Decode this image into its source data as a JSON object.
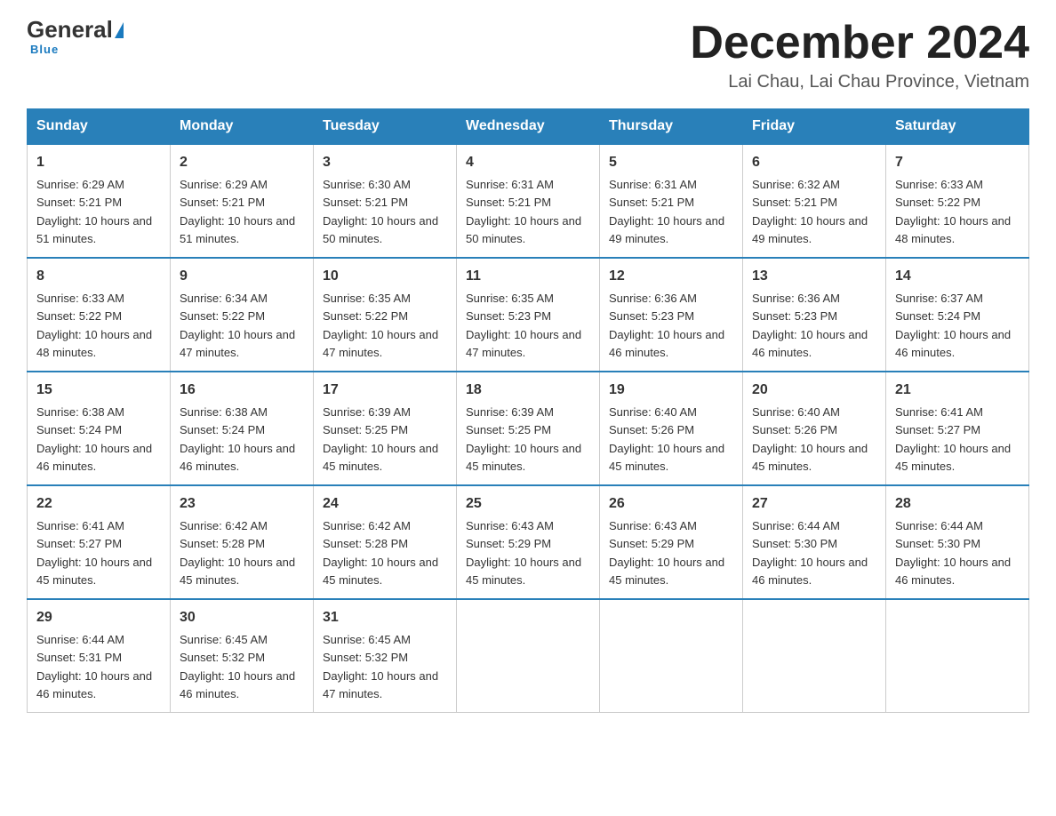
{
  "logo": {
    "general": "General",
    "blue": "Blue",
    "underline": "Blue"
  },
  "header": {
    "month_title": "December 2024",
    "location": "Lai Chau, Lai Chau Province, Vietnam"
  },
  "days_of_week": [
    "Sunday",
    "Monday",
    "Tuesday",
    "Wednesday",
    "Thursday",
    "Friday",
    "Saturday"
  ],
  "weeks": [
    [
      {
        "day": "1",
        "sunrise": "6:29 AM",
        "sunset": "5:21 PM",
        "daylight": "10 hours and 51 minutes."
      },
      {
        "day": "2",
        "sunrise": "6:29 AM",
        "sunset": "5:21 PM",
        "daylight": "10 hours and 51 minutes."
      },
      {
        "day": "3",
        "sunrise": "6:30 AM",
        "sunset": "5:21 PM",
        "daylight": "10 hours and 50 minutes."
      },
      {
        "day": "4",
        "sunrise": "6:31 AM",
        "sunset": "5:21 PM",
        "daylight": "10 hours and 50 minutes."
      },
      {
        "day": "5",
        "sunrise": "6:31 AM",
        "sunset": "5:21 PM",
        "daylight": "10 hours and 49 minutes."
      },
      {
        "day": "6",
        "sunrise": "6:32 AM",
        "sunset": "5:21 PM",
        "daylight": "10 hours and 49 minutes."
      },
      {
        "day": "7",
        "sunrise": "6:33 AM",
        "sunset": "5:22 PM",
        "daylight": "10 hours and 48 minutes."
      }
    ],
    [
      {
        "day": "8",
        "sunrise": "6:33 AM",
        "sunset": "5:22 PM",
        "daylight": "10 hours and 48 minutes."
      },
      {
        "day": "9",
        "sunrise": "6:34 AM",
        "sunset": "5:22 PM",
        "daylight": "10 hours and 47 minutes."
      },
      {
        "day": "10",
        "sunrise": "6:35 AM",
        "sunset": "5:22 PM",
        "daylight": "10 hours and 47 minutes."
      },
      {
        "day": "11",
        "sunrise": "6:35 AM",
        "sunset": "5:23 PM",
        "daylight": "10 hours and 47 minutes."
      },
      {
        "day": "12",
        "sunrise": "6:36 AM",
        "sunset": "5:23 PM",
        "daylight": "10 hours and 46 minutes."
      },
      {
        "day": "13",
        "sunrise": "6:36 AM",
        "sunset": "5:23 PM",
        "daylight": "10 hours and 46 minutes."
      },
      {
        "day": "14",
        "sunrise": "6:37 AM",
        "sunset": "5:24 PM",
        "daylight": "10 hours and 46 minutes."
      }
    ],
    [
      {
        "day": "15",
        "sunrise": "6:38 AM",
        "sunset": "5:24 PM",
        "daylight": "10 hours and 46 minutes."
      },
      {
        "day": "16",
        "sunrise": "6:38 AM",
        "sunset": "5:24 PM",
        "daylight": "10 hours and 46 minutes."
      },
      {
        "day": "17",
        "sunrise": "6:39 AM",
        "sunset": "5:25 PM",
        "daylight": "10 hours and 45 minutes."
      },
      {
        "day": "18",
        "sunrise": "6:39 AM",
        "sunset": "5:25 PM",
        "daylight": "10 hours and 45 minutes."
      },
      {
        "day": "19",
        "sunrise": "6:40 AM",
        "sunset": "5:26 PM",
        "daylight": "10 hours and 45 minutes."
      },
      {
        "day": "20",
        "sunrise": "6:40 AM",
        "sunset": "5:26 PM",
        "daylight": "10 hours and 45 minutes."
      },
      {
        "day": "21",
        "sunrise": "6:41 AM",
        "sunset": "5:27 PM",
        "daylight": "10 hours and 45 minutes."
      }
    ],
    [
      {
        "day": "22",
        "sunrise": "6:41 AM",
        "sunset": "5:27 PM",
        "daylight": "10 hours and 45 minutes."
      },
      {
        "day": "23",
        "sunrise": "6:42 AM",
        "sunset": "5:28 PM",
        "daylight": "10 hours and 45 minutes."
      },
      {
        "day": "24",
        "sunrise": "6:42 AM",
        "sunset": "5:28 PM",
        "daylight": "10 hours and 45 minutes."
      },
      {
        "day": "25",
        "sunrise": "6:43 AM",
        "sunset": "5:29 PM",
        "daylight": "10 hours and 45 minutes."
      },
      {
        "day": "26",
        "sunrise": "6:43 AM",
        "sunset": "5:29 PM",
        "daylight": "10 hours and 45 minutes."
      },
      {
        "day": "27",
        "sunrise": "6:44 AM",
        "sunset": "5:30 PM",
        "daylight": "10 hours and 46 minutes."
      },
      {
        "day": "28",
        "sunrise": "6:44 AM",
        "sunset": "5:30 PM",
        "daylight": "10 hours and 46 minutes."
      }
    ],
    [
      {
        "day": "29",
        "sunrise": "6:44 AM",
        "sunset": "5:31 PM",
        "daylight": "10 hours and 46 minutes."
      },
      {
        "day": "30",
        "sunrise": "6:45 AM",
        "sunset": "5:32 PM",
        "daylight": "10 hours and 46 minutes."
      },
      {
        "day": "31",
        "sunrise": "6:45 AM",
        "sunset": "5:32 PM",
        "daylight": "10 hours and 47 minutes."
      },
      null,
      null,
      null,
      null
    ]
  ]
}
